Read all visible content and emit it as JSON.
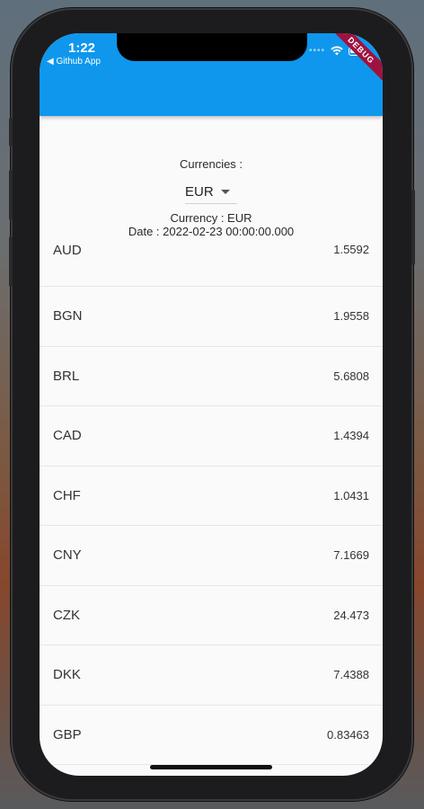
{
  "status": {
    "time": "1:22",
    "back_label": "◀ Github App"
  },
  "debug_label": "DEBUG",
  "currency_section": {
    "heading": "Currencies :",
    "selected": "EUR",
    "currency_line": "Currency : EUR",
    "date_line": "Date : 2022-02-23 00:00:00.000"
  },
  "rates": [
    {
      "code": "AUD",
      "value": "1.5592"
    },
    {
      "code": "BGN",
      "value": "1.9558"
    },
    {
      "code": "BRL",
      "value": "5.6808"
    },
    {
      "code": "CAD",
      "value": "1.4394"
    },
    {
      "code": "CHF",
      "value": "1.0431"
    },
    {
      "code": "CNY",
      "value": "7.1669"
    },
    {
      "code": "CZK",
      "value": "24.473"
    },
    {
      "code": "DKK",
      "value": "7.4388"
    },
    {
      "code": "GBP",
      "value": "0.83463"
    }
  ],
  "colors": {
    "app_bar": "#0e97ed",
    "debug_banner": "#a0123e"
  }
}
